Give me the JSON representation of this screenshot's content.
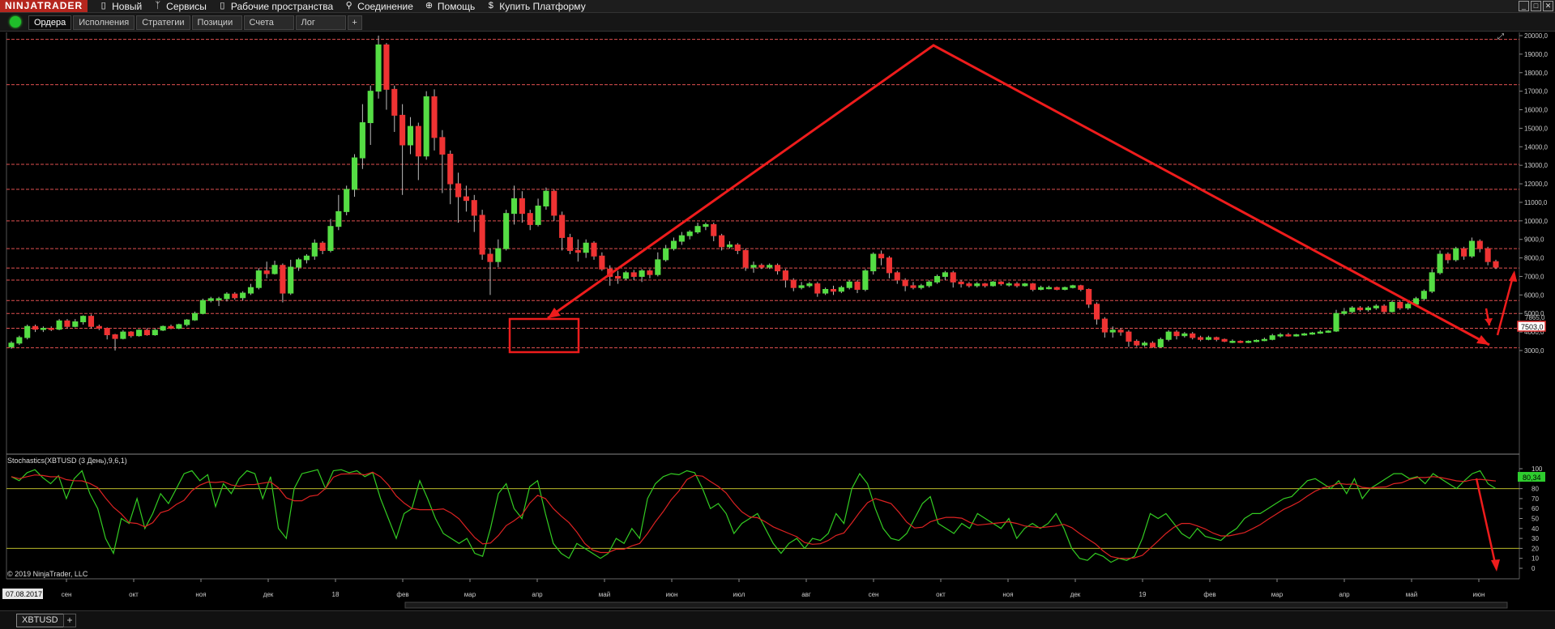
{
  "app": {
    "logo": "NINJATRADER",
    "menu": [
      {
        "label": "Новый",
        "icon": "document-icon"
      },
      {
        "label": "Сервисы",
        "icon": "wrench-icon"
      },
      {
        "label": "Рабочие пространства",
        "icon": "document-icon"
      },
      {
        "label": "Соединение",
        "icon": "plug-icon"
      },
      {
        "label": "Помощь",
        "icon": "lifebuoy-icon"
      },
      {
        "label": "Купить Платформу",
        "icon": "dollar-icon"
      }
    ],
    "window_controls": [
      "_",
      "□",
      "✕"
    ]
  },
  "tabs": [
    {
      "label": "Ордера",
      "active": true
    },
    {
      "label": "Исполнения",
      "active": false
    },
    {
      "label": "Стратегии",
      "active": false
    },
    {
      "label": "Позиции",
      "active": false
    },
    {
      "label": "Счета",
      "active": false
    },
    {
      "label": "Лог",
      "active": false
    }
  ],
  "tab_add": "+",
  "colors": {
    "up": "#55dd44",
    "down": "#ee3333",
    "level": "#e05050",
    "arrow": "#ee1c1c",
    "stoch_k": "#33cc22",
    "stoch_d": "#dd2222",
    "stoch_band": "#b8b82a",
    "axis_text": "#cccccc",
    "price_badge": "#e03030"
  },
  "instrument_tab": "XBTUSD",
  "instrument_add": "+",
  "copyright": "© 2019 NinjaTrader, LLC",
  "start_date": "07.08.2017",
  "chart_data": {
    "type": "candlestick",
    "instrument": "XBTUSD",
    "period": "3 дня",
    "price_axis": {
      "ylim": [
        3000,
        20000
      ],
      "ticks": [
        "20000,0",
        "19000,0",
        "18000,0",
        "17000,0",
        "16000,0",
        "15000,0",
        "14000,0",
        "13000,0",
        "12000,0",
        "11000,0",
        "10000,0",
        "9000,0",
        "8000,0",
        "7000,0",
        "6000,0",
        "5000,0",
        "4000,0",
        "3000,0"
      ]
    },
    "last_price": "7503,0",
    "prev_price": "7865,0",
    "levels": [
      19800,
      17350,
      13050,
      11700,
      10000,
      8500,
      7450,
      6800,
      5700,
      5000,
      4200,
      3150
    ],
    "time_axis": [
      "сен",
      "окт",
      "ноя",
      "дек",
      "18",
      "фев",
      "мар",
      "апр",
      "май",
      "июн",
      "июл",
      "авг",
      "сен",
      "окт",
      "ноя",
      "дек",
      "19",
      "фев",
      "мар",
      "апр",
      "май",
      "июн"
    ],
    "candles": [
      [
        3200,
        3400,
        3100,
        3500
      ],
      [
        3400,
        3700,
        3300,
        3800
      ],
      [
        3700,
        4300,
        3600,
        4400
      ],
      [
        4300,
        4150,
        4000,
        4400
      ],
      [
        4150,
        4200,
        4000,
        4300
      ],
      [
        4200,
        4150,
        4050,
        4300
      ],
      [
        4150,
        4600,
        4100,
        4700
      ],
      [
        4600,
        4300,
        4200,
        4700
      ],
      [
        4300,
        4550,
        4250,
        4700
      ],
      [
        4550,
        4850,
        4400,
        4900
      ],
      [
        4850,
        4300,
        4200,
        4950
      ],
      [
        4300,
        4200,
        4100,
        4400
      ],
      [
        4200,
        3850,
        3600,
        4250
      ],
      [
        3850,
        3650,
        3000,
        3900
      ],
      [
        3650,
        4000,
        3600,
        4100
      ],
      [
        4000,
        3800,
        3700,
        4050
      ],
      [
        3800,
        4100,
        3750,
        4150
      ],
      [
        4100,
        3850,
        3800,
        4200
      ],
      [
        3850,
        4100,
        3800,
        4200
      ],
      [
        4100,
        4300,
        4050,
        4350
      ],
      [
        4300,
        4200,
        4150,
        4400
      ],
      [
        4200,
        4400,
        4150,
        4450
      ],
      [
        4400,
        4650,
        4300,
        4700
      ],
      [
        4650,
        5000,
        4600,
        5100
      ],
      [
        5000,
        5700,
        4950,
        5800
      ],
      [
        5700,
        5800,
        5600,
        5900
      ],
      [
        5800,
        5800,
        5400,
        5900
      ],
      [
        5800,
        6050,
        5650,
        6150
      ],
      [
        6050,
        5850,
        5750,
        6150
      ],
      [
        5850,
        6100,
        5700,
        6200
      ],
      [
        6100,
        6400,
        6000,
        6600
      ],
      [
        6400,
        7300,
        6300,
        7450
      ],
      [
        7300,
        7150,
        6900,
        7800
      ],
      [
        7150,
        7600,
        7100,
        7850
      ],
      [
        7600,
        6100,
        5600,
        7700
      ],
      [
        6100,
        7500,
        6000,
        7900
      ],
      [
        7500,
        7900,
        7300,
        8000
      ],
      [
        7900,
        8100,
        7700,
        8200
      ],
      [
        8100,
        8800,
        7900,
        9000
      ],
      [
        8800,
        8400,
        8200,
        8900
      ],
      [
        8400,
        9700,
        8300,
        10100
      ],
      [
        9700,
        10500,
        9500,
        11400
      ],
      [
        10500,
        11700,
        10300,
        11900
      ],
      [
        11700,
        13400,
        11300,
        13600
      ],
      [
        13400,
        15300,
        12800,
        16300
      ],
      [
        15300,
        17000,
        14100,
        17300
      ],
      [
        17000,
        19500,
        16600,
        20000
      ],
      [
        19500,
        17100,
        16000,
        19600
      ],
      [
        17100,
        15700,
        14800,
        17300
      ],
      [
        15700,
        14100,
        11400,
        16300
      ],
      [
        14100,
        15100,
        13600,
        15600
      ],
      [
        15100,
        13500,
        12200,
        15300
      ],
      [
        13500,
        16700,
        13300,
        17000
      ],
      [
        16700,
        14500,
        13800,
        17100
      ],
      [
        14500,
        13600,
        11500,
        14900
      ],
      [
        13600,
        12000,
        10900,
        13800
      ],
      [
        12000,
        11300,
        9900,
        12600
      ],
      [
        11300,
        11100,
        10500,
        11900
      ],
      [
        11100,
        10300,
        9400,
        11400
      ],
      [
        10300,
        8200,
        7900,
        10600
      ],
      [
        8200,
        7800,
        6000,
        8500
      ],
      [
        7800,
        8500,
        7500,
        9000
      ],
      [
        8500,
        10400,
        8400,
        10600
      ],
      [
        10400,
        11200,
        9800,
        11900
      ],
      [
        11200,
        10400,
        9900,
        11600
      ],
      [
        10400,
        9800,
        9500,
        10600
      ],
      [
        9800,
        10800,
        9700,
        11200
      ],
      [
        10800,
        11600,
        10600,
        11800
      ],
      [
        11600,
        10300,
        10000,
        11700
      ],
      [
        10300,
        9100,
        8400,
        10500
      ],
      [
        9100,
        8400,
        8200,
        9300
      ],
      [
        8400,
        8300,
        7800,
        9000
      ],
      [
        8300,
        8800,
        8000,
        9000
      ],
      [
        8800,
        8100,
        7900,
        8900
      ],
      [
        8100,
        7400,
        7300,
        8300
      ],
      [
        7400,
        7000,
        6500,
        7600
      ],
      [
        7000,
        6900,
        6600,
        7300
      ],
      [
        6900,
        7200,
        6800,
        7300
      ],
      [
        7200,
        7000,
        6800,
        7350
      ],
      [
        7000,
        7300,
        6700,
        7400
      ],
      [
        7300,
        7100,
        6900,
        7400
      ],
      [
        7100,
        7900,
        7000,
        8300
      ],
      [
        7900,
        8500,
        7800,
        8700
      ],
      [
        8500,
        8900,
        8400,
        9100
      ],
      [
        8900,
        9200,
        8700,
        9400
      ],
      [
        9200,
        9400,
        9000,
        9500
      ],
      [
        9400,
        9700,
        9300,
        9900
      ],
      [
        9700,
        9800,
        9500,
        9900
      ],
      [
        9800,
        9200,
        8900,
        9900
      ],
      [
        9200,
        8600,
        8400,
        9300
      ],
      [
        8600,
        8700,
        8500,
        8900
      ],
      [
        8700,
        8400,
        8200,
        8800
      ],
      [
        8400,
        7500,
        7300,
        8500
      ],
      [
        7500,
        7600,
        7200,
        7800
      ],
      [
        7600,
        7500,
        7400,
        7700
      ],
      [
        7500,
        7600,
        7400,
        7700
      ],
      [
        7600,
        7300,
        7100,
        7700
      ],
      [
        7300,
        6800,
        6400,
        7400
      ],
      [
        6800,
        6400,
        6200,
        6900
      ],
      [
        6400,
        6500,
        6300,
        6700
      ],
      [
        6500,
        6600,
        6400,
        6700
      ],
      [
        6600,
        6100,
        5900,
        6700
      ],
      [
        6100,
        6300,
        6000,
        6400
      ],
      [
        6300,
        6200,
        6000,
        6500
      ],
      [
        6200,
        6400,
        6100,
        6500
      ],
      [
        6400,
        6700,
        6300,
        6800
      ],
      [
        6700,
        6300,
        6100,
        6800
      ],
      [
        6300,
        7300,
        6200,
        7400
      ],
      [
        7300,
        8200,
        7100,
        8300
      ],
      [
        8200,
        8000,
        7600,
        8400
      ],
      [
        8000,
        7200,
        6900,
        8100
      ],
      [
        7200,
        6800,
        6600,
        7300
      ],
      [
        6800,
        6500,
        6200,
        6900
      ],
      [
        6500,
        6400,
        6300,
        6700
      ],
      [
        6400,
        6500,
        6300,
        6600
      ],
      [
        6500,
        6700,
        6400,
        6800
      ],
      [
        6700,
        7000,
        6600,
        7100
      ],
      [
        7000,
        7200,
        6800,
        7300
      ],
      [
        7200,
        6700,
        6400,
        7300
      ],
      [
        6700,
        6600,
        6400,
        6800
      ],
      [
        6600,
        6500,
        6400,
        6700
      ],
      [
        6500,
        6600,
        6400,
        6700
      ],
      [
        6600,
        6500,
        6400,
        6650
      ],
      [
        6500,
        6700,
        6450,
        6750
      ],
      [
        6700,
        6600,
        6500,
        6750
      ],
      [
        6600,
        6600,
        6450,
        6700
      ],
      [
        6600,
        6500,
        6400,
        6700
      ],
      [
        6500,
        6600,
        6450,
        6650
      ],
      [
        6600,
        6300,
        6200,
        6650
      ],
      [
        6300,
        6400,
        6250,
        6500
      ],
      [
        6400,
        6400,
        6300,
        6500
      ],
      [
        6400,
        6300,
        6250,
        6450
      ],
      [
        6300,
        6400,
        6250,
        6450
      ],
      [
        6400,
        6500,
        6350,
        6550
      ],
      [
        6500,
        6300,
        6200,
        6550
      ],
      [
        6300,
        5500,
        5300,
        6350
      ],
      [
        5500,
        4700,
        4400,
        5600
      ],
      [
        4700,
        4000,
        3700,
        4800
      ],
      [
        4000,
        4100,
        3700,
        4300
      ],
      [
        4100,
        4000,
        3800,
        4200
      ],
      [
        4000,
        3500,
        3200,
        4100
      ],
      [
        3500,
        3300,
        3200,
        3600
      ],
      [
        3300,
        3400,
        3200,
        3500
      ],
      [
        3400,
        3200,
        3150,
        3500
      ],
      [
        3200,
        3600,
        3150,
        3700
      ],
      [
        3600,
        4000,
        3500,
        4100
      ],
      [
        4000,
        3800,
        3600,
        4100
      ],
      [
        3800,
        3900,
        3700,
        4000
      ],
      [
        3900,
        3700,
        3600,
        4000
      ],
      [
        3700,
        3600,
        3500,
        3800
      ],
      [
        3600,
        3700,
        3550,
        3800
      ],
      [
        3700,
        3600,
        3500,
        3750
      ],
      [
        3600,
        3500,
        3450,
        3650
      ],
      [
        3500,
        3500,
        3400,
        3600
      ],
      [
        3500,
        3450,
        3400,
        3550
      ],
      [
        3450,
        3500,
        3400,
        3550
      ],
      [
        3500,
        3550,
        3450,
        3600
      ],
      [
        3550,
        3600,
        3500,
        3700
      ],
      [
        3600,
        3800,
        3550,
        3900
      ],
      [
        3800,
        3850,
        3700,
        3950
      ],
      [
        3850,
        3800,
        3750,
        3950
      ],
      [
        3800,
        3850,
        3750,
        3900
      ],
      [
        3850,
        3900,
        3800,
        3950
      ],
      [
        3900,
        3950,
        3850,
        4000
      ],
      [
        3950,
        4000,
        3900,
        4100
      ],
      [
        4000,
        4050,
        3950,
        4100
      ],
      [
        4050,
        5000,
        4000,
        5200
      ],
      [
        5000,
        5100,
        4900,
        5300
      ],
      [
        5100,
        5300,
        5000,
        5400
      ],
      [
        5300,
        5200,
        5100,
        5400
      ],
      [
        5200,
        5300,
        5100,
        5400
      ],
      [
        5300,
        5400,
        5200,
        5500
      ],
      [
        5400,
        5100,
        5000,
        5500
      ],
      [
        5100,
        5600,
        5050,
        5700
      ],
      [
        5600,
        5300,
        5200,
        5700
      ],
      [
        5300,
        5500,
        5200,
        5600
      ],
      [
        5500,
        5800,
        5400,
        5900
      ],
      [
        5800,
        6200,
        5700,
        6300
      ],
      [
        6200,
        7200,
        6100,
        7400
      ],
      [
        7200,
        8200,
        7100,
        8400
      ],
      [
        8200,
        7900,
        7700,
        8300
      ],
      [
        7900,
        8500,
        7800,
        8600
      ],
      [
        8500,
        8100,
        7900,
        8600
      ],
      [
        8100,
        8900,
        8000,
        9100
      ],
      [
        8900,
        8500,
        8300,
        9000
      ],
      [
        8500,
        7800,
        7600,
        8600
      ],
      [
        7800,
        7500,
        7400,
        7900
      ]
    ],
    "stochastics": {
      "label": "Stochastics(XBTUSD (3 День),9,6,1)",
      "ylim": [
        0,
        100
      ],
      "ticks": [
        "100",
        "90",
        "80",
        "70",
        "60",
        "50",
        "40",
        "30",
        "20",
        "10",
        "0"
      ],
      "bands": [
        80,
        20
      ],
      "last_value": "80,34",
      "k": [
        92,
        88,
        96,
        99,
        91,
        85,
        93,
        70,
        90,
        98,
        75,
        60,
        30,
        15,
        50,
        45,
        70,
        40,
        55,
        75,
        65,
        80,
        95,
        98,
        88,
        94,
        62,
        85,
        75,
        90,
        98,
        95,
        70,
        92,
        40,
        30,
        80,
        95,
        97,
        99,
        80,
        98,
        99,
        96,
        98,
        92,
        96,
        70,
        50,
        30,
        55,
        60,
        88,
        70,
        50,
        35,
        30,
        25,
        30,
        15,
        12,
        40,
        75,
        85,
        60,
        50,
        82,
        88,
        55,
        25,
        15,
        10,
        25,
        20,
        15,
        10,
        15,
        30,
        25,
        40,
        30,
        70,
        85,
        92,
        95,
        94,
        98,
        96,
        80,
        60,
        65,
        55,
        35,
        45,
        50,
        55,
        40,
        25,
        15,
        25,
        30,
        20,
        30,
        28,
        35,
        55,
        45,
        80,
        95,
        85,
        60,
        40,
        30,
        28,
        35,
        50,
        65,
        72,
        45,
        40,
        35,
        45,
        40,
        55,
        50,
        45,
        40,
        50,
        30,
        40,
        45,
        40,
        45,
        55,
        40,
        20,
        10,
        8,
        15,
        12,
        6,
        10,
        8,
        12,
        30,
        55,
        50,
        55,
        45,
        35,
        30,
        40,
        32,
        30,
        28,
        35,
        40,
        50,
        55,
        55,
        60,
        65,
        70,
        72,
        80,
        88,
        90,
        85,
        80,
        88,
        75,
        90,
        70,
        80,
        85,
        90,
        95,
        95,
        90,
        92,
        85,
        95,
        90,
        85,
        80,
        88,
        95,
        98,
        85,
        80
      ]
    }
  }
}
